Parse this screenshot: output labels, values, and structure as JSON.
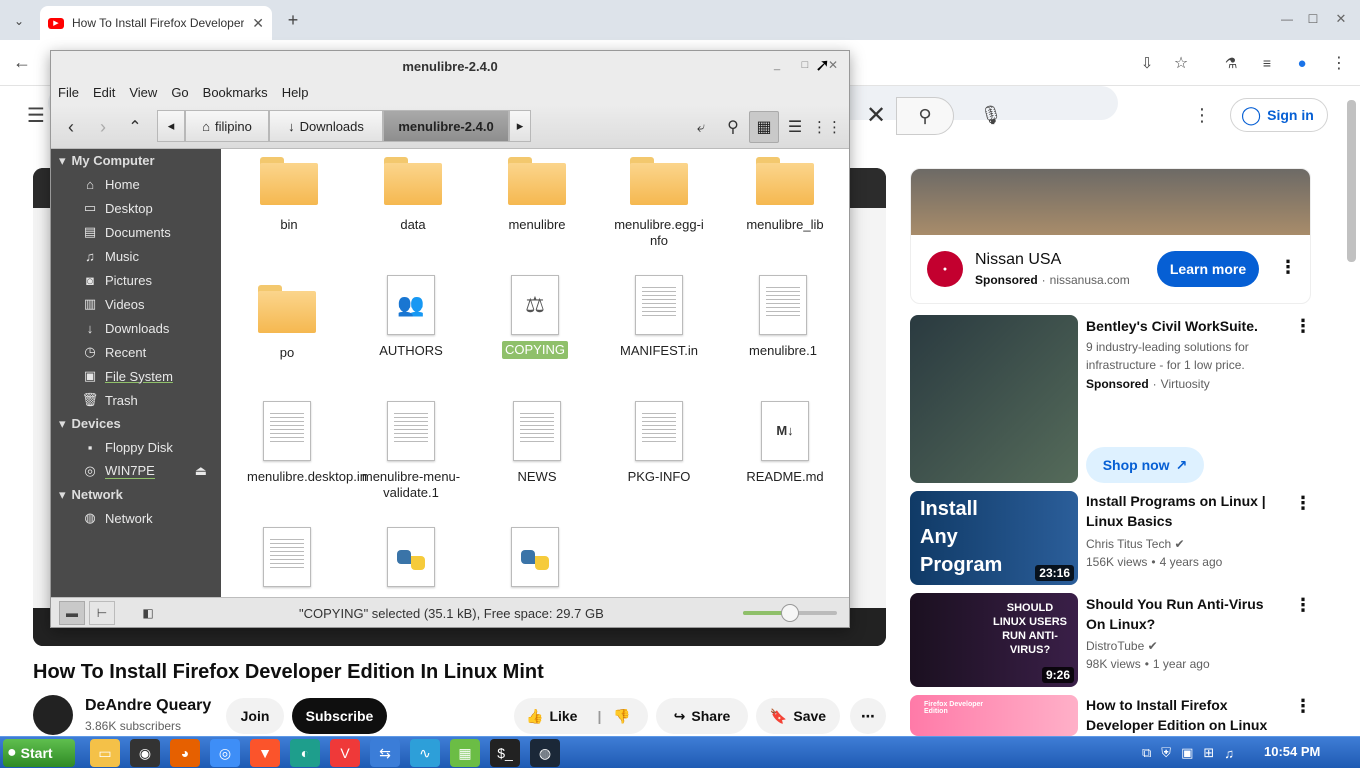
{
  "browser": {
    "tab_title": "How To Install Firefox Developer Edition In Linux Mint"
  },
  "youtube": {
    "sign_in": "Sign in",
    "video_title": "How To Install Firefox Developer Edition In Linux Mint",
    "channel": "DeAndre Queary",
    "subscribers": "3.86K subscribers",
    "join": "Join",
    "subscribe": "Subscribe",
    "like": "Like",
    "share": "Share",
    "save": "Save",
    "ad": {
      "advertiser": "Nissan USA",
      "sponsored": "Sponsored",
      "domain": "nissanusa.com",
      "cta": "Learn more"
    },
    "promo": {
      "title": "Bentley's Civil WorkSuite.",
      "desc": "9 industry-leading solutions for infrastructure - for 1 low price.",
      "sponsored": "Sponsored",
      "sponsor": "Virtuosity",
      "cta": "Shop now"
    },
    "recommendations": [
      {
        "title": "Install Programs on Linux | Linux Basics",
        "channel": "Chris Titus Tech",
        "views": "156K views",
        "age": "4 years ago",
        "duration": "23:16",
        "thumb_text": "Install Any Program"
      },
      {
        "title": "Should You Run Anti-Virus On Linux?",
        "channel": "DistroTube",
        "views": "98K views",
        "age": "1 year ago",
        "duration": "9:26",
        "thumb_text": "SHOULD LINUX USERS RUN ANTI-VIRUS?"
      },
      {
        "title": "How to Install Firefox Developer Edition on Linux (Plus how to...",
        "thumb_text": "Firefox Developer Edition"
      }
    ]
  },
  "filemanager": {
    "title": "menulibre-2.4.0",
    "menu": [
      "File",
      "Edit",
      "View",
      "Go",
      "Bookmarks",
      "Help"
    ],
    "breadcrumbs": [
      "filipino",
      "Downloads",
      "menulibre-2.4.0"
    ],
    "sidebar": {
      "my_computer": "My Computer",
      "places": [
        "Home",
        "Desktop",
        "Documents",
        "Music",
        "Pictures",
        "Videos",
        "Downloads",
        "Recent",
        "File System",
        "Trash"
      ],
      "devices": "Devices",
      "device_items": [
        "Floppy Disk",
        "WIN7PE"
      ],
      "network": "Network",
      "network_items": [
        "Network"
      ]
    },
    "files": [
      {
        "name": "bin",
        "kind": "folder"
      },
      {
        "name": "data",
        "kind": "folder"
      },
      {
        "name": "menulibre",
        "kind": "folder"
      },
      {
        "name": "menulibre.egg-info",
        "kind": "folder"
      },
      {
        "name": "menulibre_lib",
        "kind": "folder"
      },
      {
        "name": "po",
        "kind": "folder"
      },
      {
        "name": "AUTHORS",
        "kind": "authors"
      },
      {
        "name": "COPYING",
        "kind": "license"
      },
      {
        "name": "MANIFEST.in",
        "kind": "text"
      },
      {
        "name": "menulibre.1",
        "kind": "text"
      },
      {
        "name": "menulibre.desktop.in",
        "kind": "text"
      },
      {
        "name": "menulibre-menu-validate.1",
        "kind": "text"
      },
      {
        "name": "NEWS",
        "kind": "text"
      },
      {
        "name": "PKG-INFO",
        "kind": "text"
      },
      {
        "name": "README.md",
        "kind": "markdown"
      },
      {
        "name": "",
        "kind": "text"
      },
      {
        "name": "",
        "kind": "python"
      },
      {
        "name": "",
        "kind": "python"
      }
    ],
    "status": "\"COPYING\" selected (35.1 kB), Free space: 29.7 GB",
    "zoom_level": 0.5
  },
  "taskbar": {
    "start": "Start",
    "clock": "10:54 PM"
  },
  "colors": {
    "yt_blue": "#065fd4",
    "selection_green": "#8fc06a",
    "taskbar_blue": "#2a66c2",
    "sidebar_dark": "#4a4a4a"
  }
}
